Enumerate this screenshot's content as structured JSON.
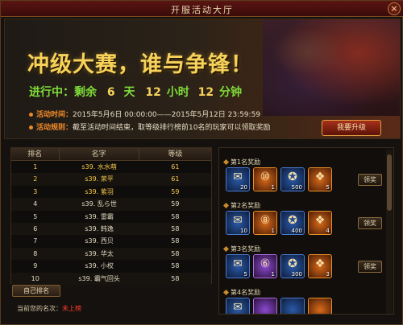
{
  "window": {
    "title": "开服活动大厅",
    "close_glyph": "×"
  },
  "banner": {
    "headline": "冲级大赛，谁与争锋！",
    "countdown": {
      "prefix": "进行中：剩余",
      "days": "6",
      "days_unit": "天",
      "hours": "12",
      "hours_unit": "小时",
      "minutes": "12",
      "minutes_unit": "分钟"
    },
    "time_label": "活动时间：",
    "time_value": "2015年5月6日 00:00:00——2015年5月12日 23:59:59",
    "rule_label": "活动规则：",
    "rule_value": "截至活动时间结束，取等级排行榜前10名的玩家可以领取奖励",
    "upgrade_button": "我要升级"
  },
  "ranking": {
    "headers": [
      "排名",
      "名字",
      "等级"
    ],
    "rows": [
      {
        "rank": "1",
        "name": "s39. 水水萌",
        "level": "61"
      },
      {
        "rank": "2",
        "name": "s39. 荣平",
        "level": "61"
      },
      {
        "rank": "3",
        "name": "s39. 紫羽",
        "level": "59"
      },
      {
        "rank": "4",
        "name": "s39. 乱ら世",
        "level": "59"
      },
      {
        "rank": "5",
        "name": "s39. 雷霸",
        "level": "58"
      },
      {
        "rank": "6",
        "name": "s39. 韩逸",
        "level": "58"
      },
      {
        "rank": "7",
        "name": "s39. 西贝",
        "level": "58"
      },
      {
        "rank": "8",
        "name": "s39. 华太",
        "level": "58"
      },
      {
        "rank": "9",
        "name": "s39. 小权",
        "level": "58"
      },
      {
        "rank": "10",
        "name": "s39. 霸气回头",
        "level": "58"
      }
    ],
    "my_rank_button": "自己排名",
    "my_rank_label": "当前您的名次：",
    "my_rank_value": "未上榜"
  },
  "rewards": {
    "claim_label": "领奖",
    "blocks": [
      {
        "label": "第1名奖励",
        "items": [
          {
            "icon": "scroll-icon",
            "glyph": "✉",
            "count": "20",
            "color": "blue"
          },
          {
            "icon": "badge-icon",
            "glyph": "⑩",
            "count": "1",
            "color": "orange"
          },
          {
            "icon": "coin-bag-icon",
            "glyph": "✪",
            "count": "500",
            "color": "blue"
          },
          {
            "icon": "gift-box-icon",
            "glyph": "❖",
            "count": "5",
            "color": "orange"
          }
        ]
      },
      {
        "label": "第2名奖励",
        "items": [
          {
            "icon": "scroll-icon",
            "glyph": "✉",
            "count": "10",
            "color": "blue"
          },
          {
            "icon": "badge-icon",
            "glyph": "⑧",
            "count": "1",
            "color": "orange"
          },
          {
            "icon": "coin-bag-icon",
            "glyph": "✪",
            "count": "400",
            "color": "blue"
          },
          {
            "icon": "gift-box-icon",
            "glyph": "❖",
            "count": "4",
            "color": "orange"
          }
        ]
      },
      {
        "label": "第3名奖励",
        "items": [
          {
            "icon": "scroll-icon",
            "glyph": "✉",
            "count": "5",
            "color": "blue"
          },
          {
            "icon": "badge-icon",
            "glyph": "⑥",
            "count": "1",
            "color": "purple"
          },
          {
            "icon": "coin-bag-icon",
            "glyph": "✪",
            "count": "300",
            "color": "blue"
          },
          {
            "icon": "gift-box-icon",
            "glyph": "❖",
            "count": "3",
            "color": "orange"
          }
        ]
      },
      {
        "label": "第4名奖励",
        "items": [
          {
            "icon": "scroll-icon",
            "glyph": "✉",
            "count": "",
            "color": "blue"
          },
          {
            "icon": "badge-icon",
            "glyph": "",
            "count": "",
            "color": "purple"
          },
          {
            "icon": "coin-bag-icon",
            "glyph": "",
            "count": "",
            "color": "blue"
          },
          {
            "icon": "gift-box-icon",
            "glyph": "",
            "count": "",
            "color": "orange"
          }
        ]
      }
    ]
  },
  "colors": {
    "headline": "#f6d25a",
    "countdown_green": "#7fdc3a",
    "not_ranked_red": "#ff3b2a"
  }
}
